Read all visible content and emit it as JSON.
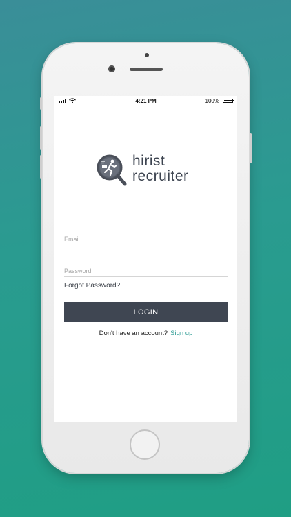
{
  "status_bar": {
    "time": "4:21 PM",
    "battery": "100%",
    "signal_icon": "signal-icon",
    "wifi_icon": "wifi-icon",
    "battery_icon": "battery-icon"
  },
  "logo": {
    "line1": "hirist",
    "line2": "recruiter",
    "icon": "magnifier-runner-icon"
  },
  "form": {
    "email_placeholder": "Email",
    "password_placeholder": "Password",
    "forgot_label": "Forgot Password?",
    "login_label": "LOGIN",
    "no_account_text": "Don't have an account?",
    "signup_label": "Sign up"
  },
  "colors": {
    "background_top": "#3a8e98",
    "background_bottom": "#1f9e84",
    "button": "#3f4652",
    "link": "#2a9a92",
    "logo_text": "#3d4450"
  }
}
